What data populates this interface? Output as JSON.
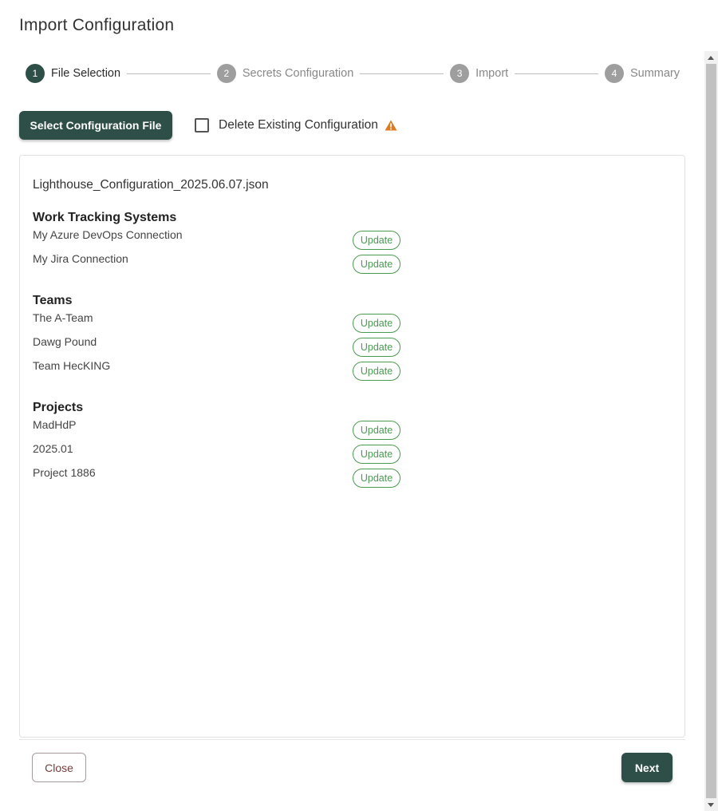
{
  "dialog": {
    "title": "Import Configuration"
  },
  "stepper": {
    "steps": [
      {
        "number": "1",
        "label": "File Selection",
        "active": true
      },
      {
        "number": "2",
        "label": "Secrets Configuration",
        "active": false
      },
      {
        "number": "3",
        "label": "Import",
        "active": false
      },
      {
        "number": "4",
        "label": "Summary",
        "active": false
      }
    ]
  },
  "toolbar": {
    "select_file_label": "Select Configuration File",
    "delete_existing_label": "Delete Existing Configuration",
    "delete_existing_checked": false,
    "warning_icon": "warning-triangle-icon",
    "warning_color": "#e07a1f"
  },
  "content": {
    "file_name": "Lighthouse_Configuration_2025.06.07.json",
    "sections": [
      {
        "heading": "Work Tracking Systems",
        "items": [
          {
            "name": "My Azure DevOps Connection",
            "status": "Update"
          },
          {
            "name": "My Jira Connection",
            "status": "Update"
          }
        ]
      },
      {
        "heading": "Teams",
        "items": [
          {
            "name": "The A-Team",
            "status": "Update"
          },
          {
            "name": "Dawg Pound",
            "status": "Update"
          },
          {
            "name": "Team HecKING",
            "status": "Update"
          }
        ]
      },
      {
        "heading": "Projects",
        "items": [
          {
            "name": "MadHdP",
            "status": "Update"
          },
          {
            "name": "2025.01",
            "status": "Update"
          },
          {
            "name": "Project 1886",
            "status": "Update"
          }
        ]
      }
    ]
  },
  "footer": {
    "close_label": "Close",
    "next_label": "Next"
  },
  "colors": {
    "primary": "#2e4f47",
    "badge": "#4a9a52",
    "step_inactive": "#9e9e9e"
  }
}
